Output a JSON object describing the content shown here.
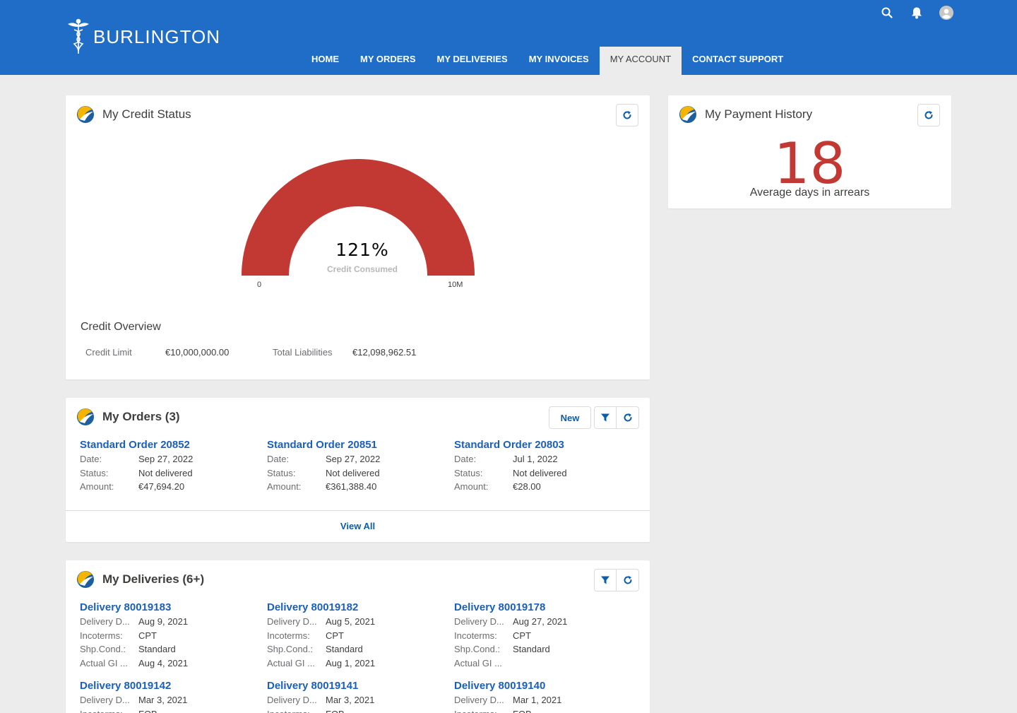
{
  "header": {
    "brand": "BURLINGTON",
    "nav": [
      {
        "label": "HOME"
      },
      {
        "label": "MY ORDERS"
      },
      {
        "label": "MY DELIVERIES"
      },
      {
        "label": "MY INVOICES"
      },
      {
        "label": "MY ACCOUNT",
        "active": true
      },
      {
        "label": "CONTACT SUPPORT"
      }
    ],
    "icons": [
      "search-icon",
      "bell-icon",
      "user-avatar-icon"
    ]
  },
  "credit_status": {
    "title": "My Credit Status",
    "gauge": {
      "percent_label": "121%",
      "sub_label": "Credit Consumed",
      "min_label": "0",
      "max_label": "10M",
      "fill_fraction": 1.0,
      "color": "#c23934"
    },
    "overview_title": "Credit Overview",
    "credit_limit_label": "Credit Limit",
    "credit_limit_value": "€10,000,000.00",
    "total_liabilities_label": "Total Liabilities",
    "total_liabilities_value": "€12,098,962.51"
  },
  "payment_history": {
    "title": "My Payment History",
    "value": "18",
    "sub_label": "Average days in arrears",
    "value_color": "#c23934"
  },
  "orders": {
    "title": "My Orders (3)",
    "new_label": "New",
    "view_all_label": "View All",
    "items": [
      {
        "title": "Standard Order 20852",
        "rows": [
          {
            "l": "Date:",
            "v": "Sep 27, 2022"
          },
          {
            "l": "Status:",
            "v": "Not delivered"
          },
          {
            "l": "Amount:",
            "v": "€47,694.20"
          }
        ]
      },
      {
        "title": "Standard Order 20851",
        "rows": [
          {
            "l": "Date:",
            "v": "Sep 27, 2022"
          },
          {
            "l": "Status:",
            "v": "Not delivered"
          },
          {
            "l": "Amount:",
            "v": "€361,388.40"
          }
        ]
      },
      {
        "title": "Standard Order 20803",
        "rows": [
          {
            "l": "Date:",
            "v": "Jul 1, 2022"
          },
          {
            "l": "Status:",
            "v": "Not delivered"
          },
          {
            "l": "Amount:",
            "v": "€28.00"
          }
        ]
      }
    ]
  },
  "deliveries": {
    "title": "My Deliveries (6+)",
    "items": [
      {
        "title": "Delivery 80019183",
        "rows": [
          {
            "l": "Delivery D...",
            "v": "Aug 9, 2021"
          },
          {
            "l": "Incoterms:",
            "v": "CPT"
          },
          {
            "l": "Shp.Cond.:",
            "v": "Standard"
          },
          {
            "l": "Actual GI ...",
            "v": "Aug 4, 2021"
          }
        ]
      },
      {
        "title": "Delivery 80019182",
        "rows": [
          {
            "l": "Delivery D...",
            "v": "Aug 5, 2021"
          },
          {
            "l": "Incoterms:",
            "v": "CPT"
          },
          {
            "l": "Shp.Cond.:",
            "v": "Standard"
          },
          {
            "l": "Actual GI ...",
            "v": "Aug 1, 2021"
          }
        ]
      },
      {
        "title": "Delivery 80019178",
        "rows": [
          {
            "l": "Delivery D...",
            "v": "Aug 27, 2021"
          },
          {
            "l": "Incoterms:",
            "v": "CPT"
          },
          {
            "l": "Shp.Cond.:",
            "v": "Standard"
          },
          {
            "l": "Actual GI ...",
            "v": ""
          }
        ]
      },
      {
        "title": "Delivery 80019142",
        "rows": [
          {
            "l": "Delivery D...",
            "v": "Mar 3, 2021"
          },
          {
            "l": "Incoterms:",
            "v": "FOB"
          }
        ]
      },
      {
        "title": "Delivery 80019141",
        "rows": [
          {
            "l": "Delivery D...",
            "v": "Mar 3, 2021"
          },
          {
            "l": "Incoterms:",
            "v": "FOB"
          }
        ]
      },
      {
        "title": "Delivery 80019140",
        "rows": [
          {
            "l": "Delivery D...",
            "v": "Mar 1, 2021"
          },
          {
            "l": "Incoterms:",
            "v": "FOB"
          }
        ]
      }
    ]
  }
}
